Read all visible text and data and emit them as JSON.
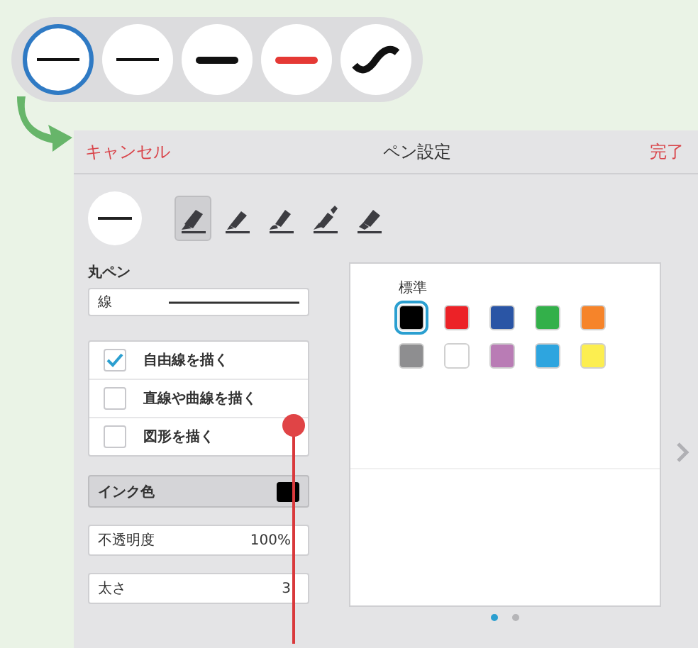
{
  "presets": [
    {
      "kind": "thin",
      "color": "#111111",
      "selected": true
    },
    {
      "kind": "thin",
      "color": "#111111",
      "selected": false
    },
    {
      "kind": "thick",
      "color": "#111111",
      "selected": false
    },
    {
      "kind": "thick",
      "color": "#e53935",
      "selected": false
    },
    {
      "kind": "wave",
      "color": "#111111",
      "selected": false
    }
  ],
  "header": {
    "cancel": "キャンセル",
    "title": "ペン設定",
    "done": "完了"
  },
  "tools": [
    {
      "kind": "marker",
      "selected": true
    },
    {
      "kind": "felt",
      "selected": false
    },
    {
      "kind": "brush",
      "selected": false
    },
    {
      "kind": "fountain",
      "selected": false
    },
    {
      "kind": "highlighter",
      "selected": false
    }
  ],
  "pen_name": "丸ペン",
  "line_field": {
    "label": "線"
  },
  "draw_modes": [
    {
      "label": "自由線を描く",
      "checked": true
    },
    {
      "label": "直線や曲線を描く",
      "checked": false
    },
    {
      "label": "図形を描く",
      "checked": false
    }
  ],
  "ink": {
    "label": "インク色",
    "color": "#000000"
  },
  "opacity": {
    "label": "不透明度",
    "value": "100%"
  },
  "thickness": {
    "label": "太さ",
    "value": "3"
  },
  "palette": {
    "title": "標準",
    "swatches": [
      {
        "color": "#000000",
        "selected": true
      },
      {
        "color": "#ec2227",
        "selected": false
      },
      {
        "color": "#2a55a5",
        "selected": false
      },
      {
        "color": "#33b04a",
        "selected": false
      },
      {
        "color": "#f6842a",
        "selected": false
      },
      {
        "color": "#8e8e90",
        "selected": false
      },
      {
        "color": "#ffffff",
        "selected": false
      },
      {
        "color": "#b97cb5",
        "selected": false
      },
      {
        "color": "#2ea5df",
        "selected": false
      },
      {
        "color": "#fcee50",
        "selected": false
      }
    ]
  },
  "pages": [
    {
      "selected": true
    },
    {
      "selected": false
    }
  ]
}
